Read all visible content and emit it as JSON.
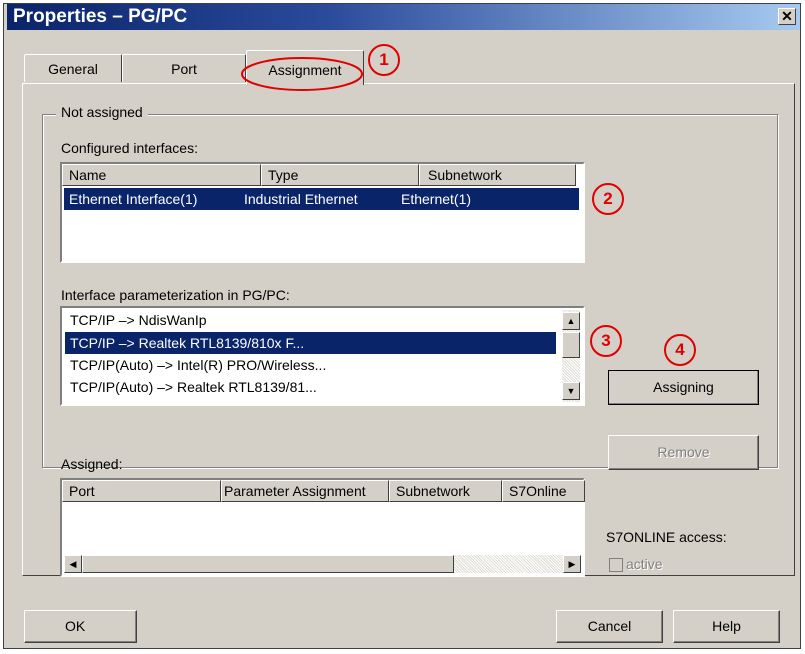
{
  "window": {
    "title": "Properties – PG/PC",
    "close_glyph": "✕"
  },
  "tabs": [
    {
      "label": "General"
    },
    {
      "label": "Port"
    },
    {
      "label": "Assignment",
      "active": true
    }
  ],
  "group": {
    "label": "Not assigned"
  },
  "configured": {
    "label": "Configured interfaces:",
    "columns": [
      "Name",
      "Type",
      "Subnetwork"
    ],
    "rows": [
      {
        "name": "Ethernet Interface(1)",
        "type": "Industrial Ethernet",
        "subnetwork": "Ethernet(1)",
        "selected": true
      }
    ]
  },
  "parameterization": {
    "label": "Interface parameterization in PG/PC:",
    "items": [
      {
        "text": "TCP/IP –> NdisWanIp"
      },
      {
        "text": "TCP/IP –> Realtek RTL8139/810x F...",
        "selected": true
      },
      {
        "text": "TCP/IP(Auto) –> Intel(R) PRO/Wireless..."
      },
      {
        "text": "TCP/IP(Auto) –> Realtek RTL8139/81..."
      }
    ]
  },
  "buttons": {
    "assigning": "Assigning",
    "remove": "Remove",
    "ok": "OK",
    "cancel": "Cancel",
    "help": "Help"
  },
  "assigned": {
    "label": "Assigned:",
    "columns": [
      "Port",
      "Parameter Assignment",
      "Subnetwork",
      "S7Online"
    ]
  },
  "s7online": {
    "label": "S7ONLINE access:",
    "checkbox_label": "active",
    "checked": false,
    "enabled": false
  },
  "callouts": [
    "1",
    "2",
    "3",
    "4"
  ],
  "colors": {
    "callout": "#e00000",
    "selection": "#0a246a",
    "title_start": "#0a246a",
    "title_end": "#a6caf0"
  }
}
